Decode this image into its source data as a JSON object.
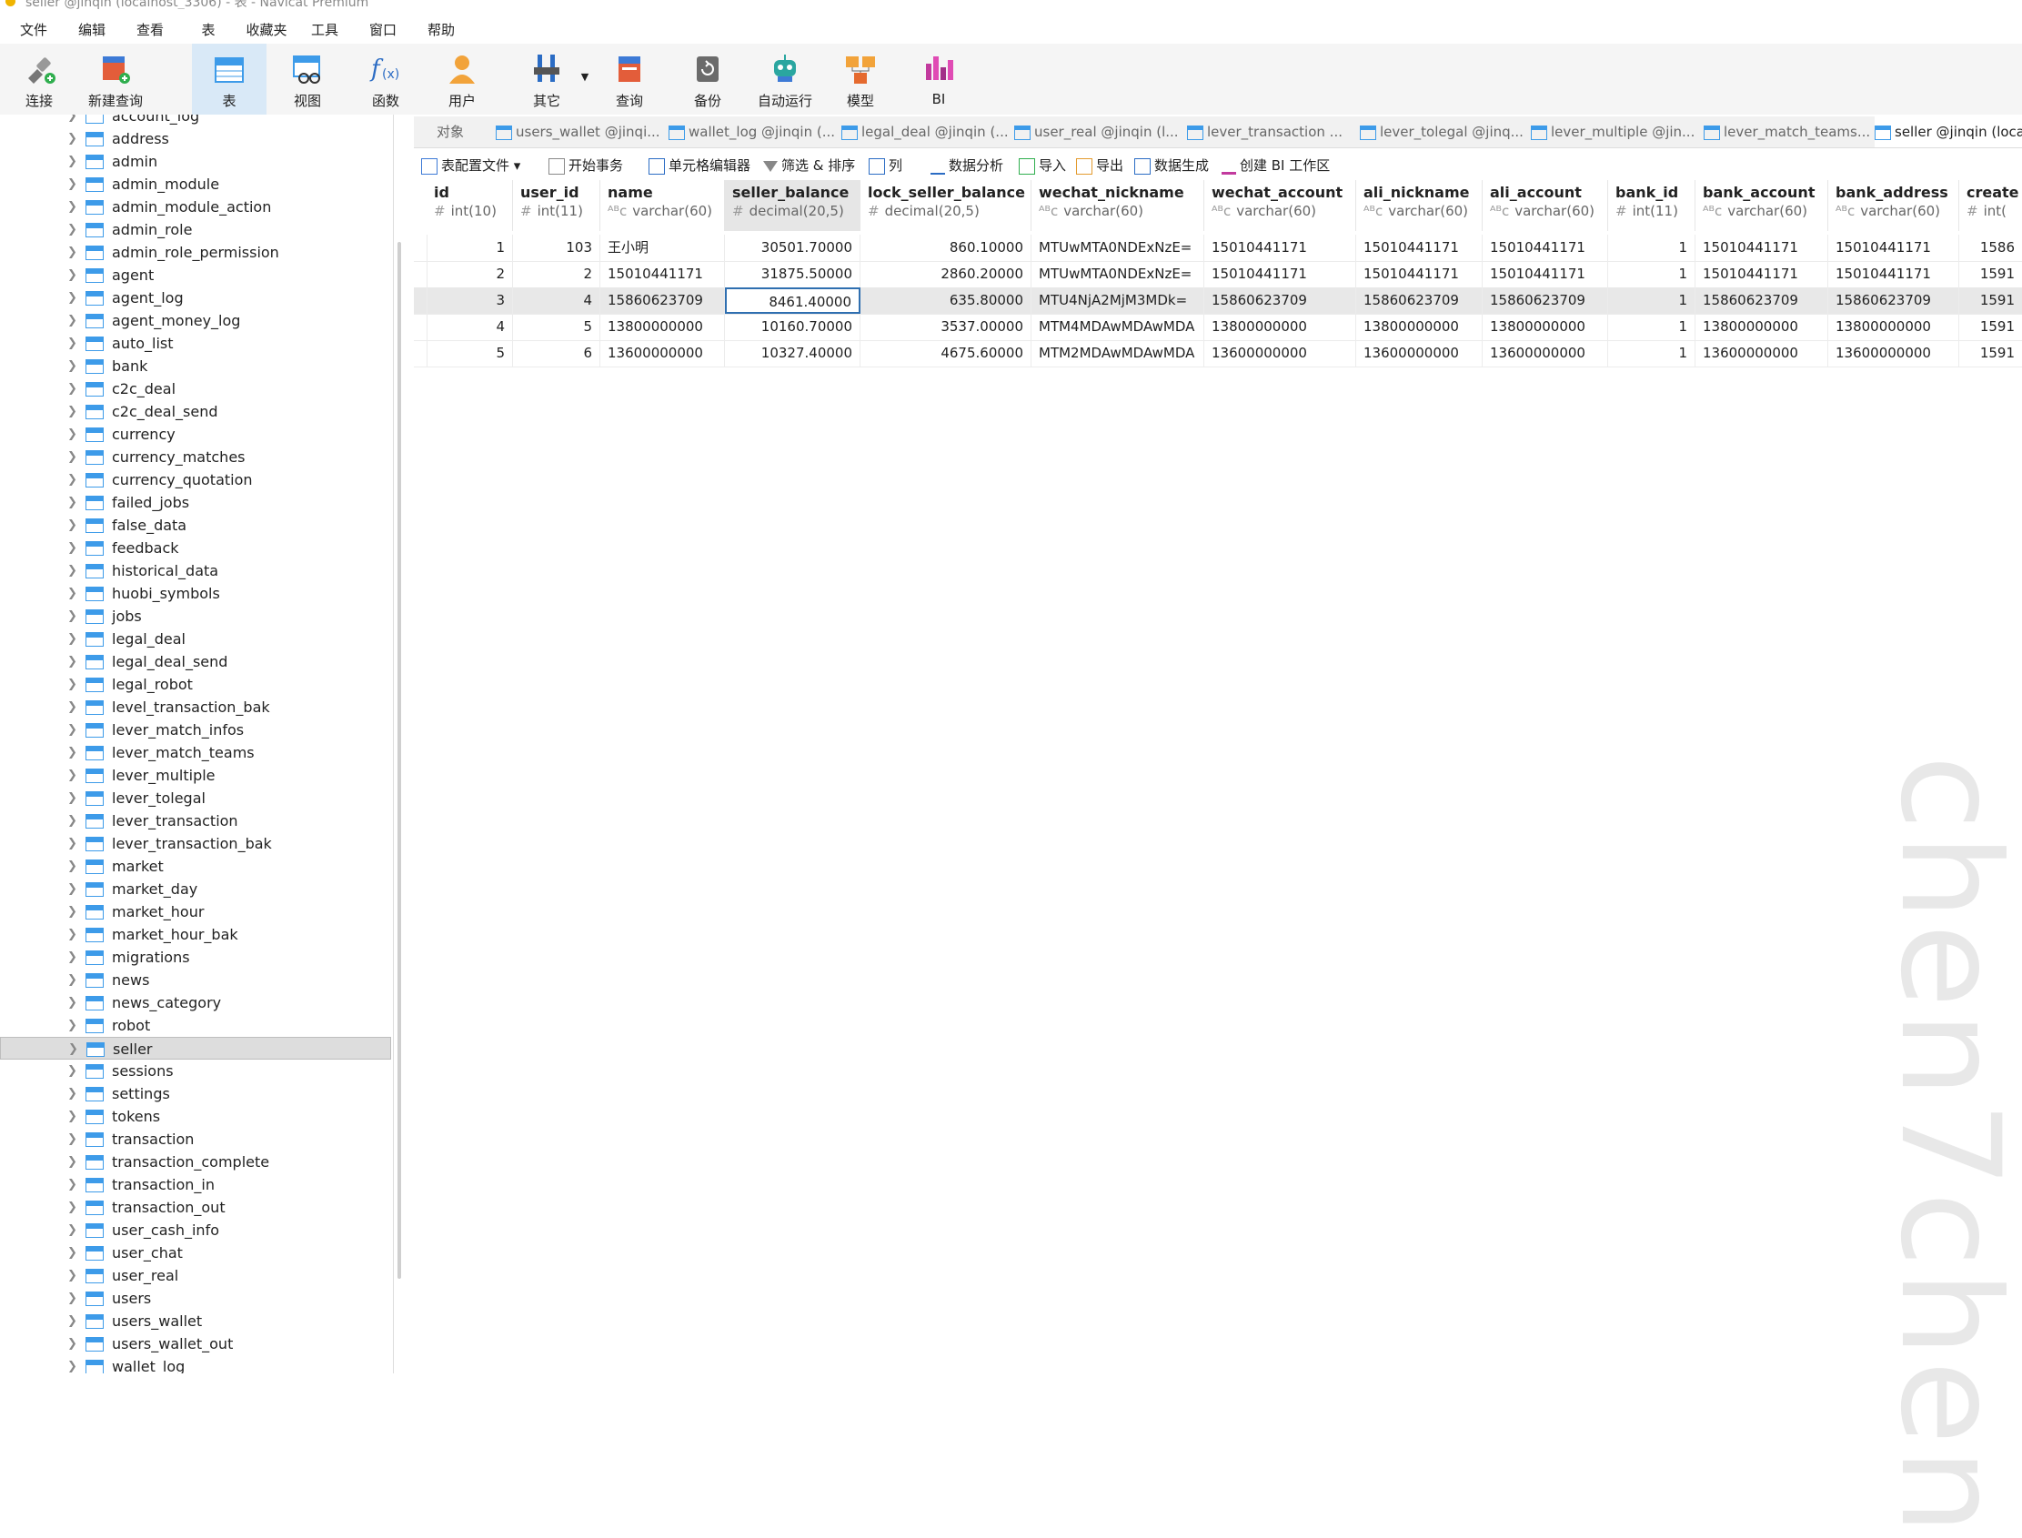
{
  "window": {
    "title": "seller @jinqin (localhost_3306) - 表 - Navicat Premium"
  },
  "menu": [
    "文件",
    "编辑",
    "查看",
    "表",
    "收藏夹",
    "工具",
    "窗口",
    "帮助"
  ],
  "toolbar": [
    {
      "label": "连接",
      "icon": "plug-icon"
    },
    {
      "label": "新建查询",
      "icon": "new-query-icon"
    },
    {
      "label": "表",
      "icon": "table-icon"
    },
    {
      "label": "视图",
      "icon": "view-icon"
    },
    {
      "label": "函数",
      "icon": "function-icon"
    },
    {
      "label": "用户",
      "icon": "user-icon"
    },
    {
      "label": "其它",
      "icon": "tools-icon"
    },
    {
      "label": "查询",
      "icon": "query-icon"
    },
    {
      "label": "备份",
      "icon": "backup-icon"
    },
    {
      "label": "自动运行",
      "icon": "robot-icon"
    },
    {
      "label": "模型",
      "icon": "model-icon"
    },
    {
      "label": "BI",
      "icon": "bi-icon"
    }
  ],
  "tree": [
    "account_log",
    "address",
    "admin",
    "admin_module",
    "admin_module_action",
    "admin_role",
    "admin_role_permission",
    "agent",
    "agent_log",
    "agent_money_log",
    "auto_list",
    "bank",
    "c2c_deal",
    "c2c_deal_send",
    "currency",
    "currency_matches",
    "currency_quotation",
    "failed_jobs",
    "false_data",
    "feedback",
    "historical_data",
    "huobi_symbols",
    "jobs",
    "legal_deal",
    "legal_deal_send",
    "legal_robot",
    "level_transaction_bak",
    "lever_match_infos",
    "lever_match_teams",
    "lever_multiple",
    "lever_tolegal",
    "lever_transaction",
    "lever_transaction_bak",
    "market",
    "market_day",
    "market_hour",
    "market_hour_bak",
    "migrations",
    "news",
    "news_category",
    "robot",
    "seller",
    "sessions",
    "settings",
    "tokens",
    "transaction",
    "transaction_complete",
    "transaction_in",
    "transaction_out",
    "user_cash_info",
    "user_chat",
    "user_real",
    "users",
    "users_wallet",
    "users_wallet_out",
    "wallet_log"
  ],
  "selected_table": "seller",
  "tabs": [
    "对象",
    "users_wallet @jinqi...",
    "wallet_log @jinqin (...",
    "legal_deal @jinqin (...",
    "user_real @jinqin (l...",
    "lever_transaction ...",
    "lever_tolegal @jinq...",
    "lever_multiple @jin...",
    "lever_match_teams...",
    "seller @jinqin (loca"
  ],
  "subtoolbar": [
    "表配置文件",
    "开始事务",
    "单元格编辑器",
    "筛选 & 排序",
    "列",
    "数据分析",
    "导入",
    "导出",
    "数据生成",
    "创建 BI 工作区"
  ],
  "columns": [
    {
      "name": "id",
      "type": "int(10)",
      "icon": "#"
    },
    {
      "name": "user_id",
      "type": "int(11)",
      "icon": "#"
    },
    {
      "name": "name",
      "type": "varchar(60)",
      "icon": "ᴬᴮc"
    },
    {
      "name": "seller_balance",
      "type": "decimal(20,5)",
      "icon": "#"
    },
    {
      "name": "lock_seller_balance",
      "type": "decimal(20,5)",
      "icon": "#"
    },
    {
      "name": "wechat_nickname",
      "type": "varchar(60)",
      "icon": "ᴬᴮc"
    },
    {
      "name": "wechat_account",
      "type": "varchar(60)",
      "icon": "ᴬᴮc"
    },
    {
      "name": "ali_nickname",
      "type": "varchar(60)",
      "icon": "ᴬᴮc"
    },
    {
      "name": "ali_account",
      "type": "varchar(60)",
      "icon": "ᴬᴮc"
    },
    {
      "name": "bank_id",
      "type": "int(11)",
      "icon": "#"
    },
    {
      "name": "bank_account",
      "type": "varchar(60)",
      "icon": "ᴬᴮc"
    },
    {
      "name": "bank_address",
      "type": "varchar(60)",
      "icon": "ᴬᴮc"
    },
    {
      "name": "create",
      "type": "int(",
      "icon": "#"
    }
  ],
  "rows": [
    [
      "1",
      "103",
      "王小明",
      "30501.70000",
      "860.10000",
      "MTUwMTA0NDExNzE=",
      "15010441171",
      "15010441171",
      "15010441171",
      "1",
      "15010441171",
      "15010441171",
      "1586"
    ],
    [
      "2",
      "2",
      "15010441171",
      "31875.50000",
      "2860.20000",
      "MTUwMTA0NDExNzE=",
      "15010441171",
      "15010441171",
      "15010441171",
      "1",
      "15010441171",
      "15010441171",
      "1591"
    ],
    [
      "3",
      "4",
      "15860623709",
      "8461.40000",
      "635.80000",
      "MTU4NjA2MjM3MDk=",
      "15860623709",
      "15860623709",
      "15860623709",
      "1",
      "15860623709",
      "15860623709",
      "1591"
    ],
    [
      "4",
      "5",
      "13800000000",
      "10160.70000",
      "3537.00000",
      "MTM4MDAwMDAwMDA",
      "13800000000",
      "13800000000",
      "13800000000",
      "1",
      "13800000000",
      "13800000000",
      "1591"
    ],
    [
      "5",
      "6",
      "13600000000",
      "10327.40000",
      "4675.60000",
      "MTM2MDAwMDAwMDA",
      "13600000000",
      "13600000000",
      "13600000000",
      "1",
      "13600000000",
      "13600000000",
      "1591"
    ]
  ],
  "watermark": "chen7chen"
}
